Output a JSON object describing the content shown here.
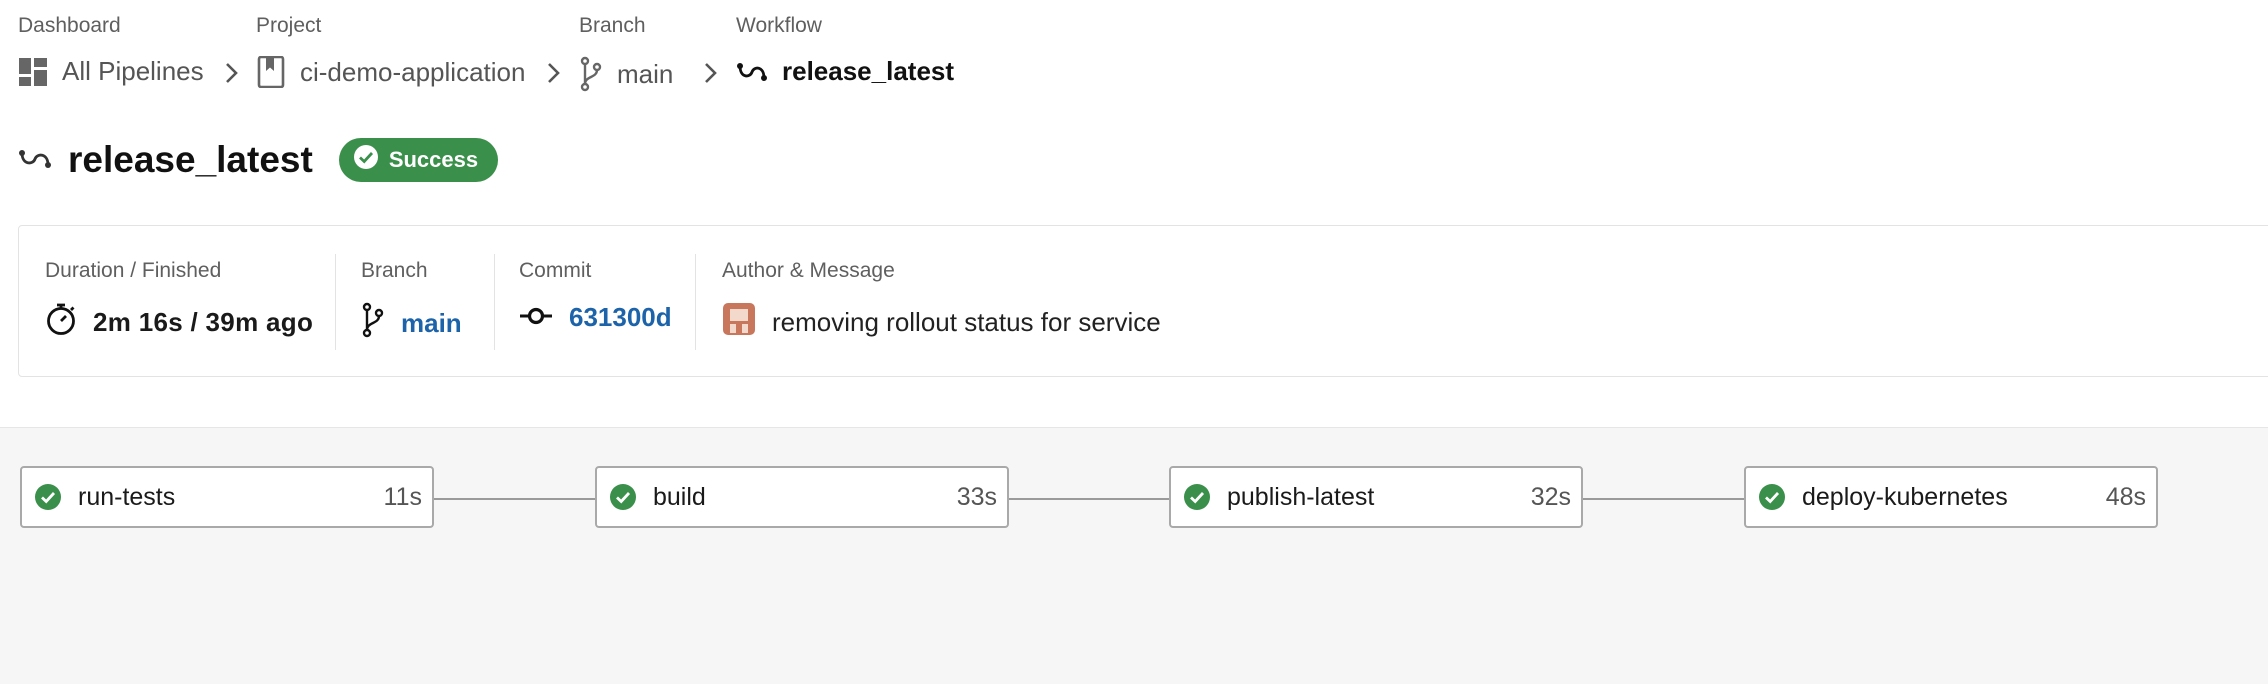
{
  "breadcrumb": {
    "dashboard": {
      "caption": "Dashboard",
      "label": "All Pipelines",
      "icon": "dashboard-icon"
    },
    "project": {
      "caption": "Project",
      "label": "ci-demo-application",
      "icon": "bookmark-icon"
    },
    "branch": {
      "caption": "Branch",
      "label": "main",
      "icon": "git-branch-icon"
    },
    "workflow": {
      "caption": "Workflow",
      "label": "release_latest",
      "icon": "workflow-icon"
    }
  },
  "header": {
    "title": "release_latest",
    "status": "Success",
    "status_color": "#3a8f4b"
  },
  "info": {
    "duration": {
      "label": "Duration / Finished",
      "value": "2m 16s / 39m ago",
      "icon": "stopwatch-icon"
    },
    "branch": {
      "label": "Branch",
      "value": "main",
      "icon": "git-branch-icon"
    },
    "commit": {
      "label": "Commit",
      "value": "631300d",
      "icon": "commit-icon"
    },
    "author": {
      "label": "Author & Message",
      "message": "removing rollout status for service",
      "icon": "avatar"
    }
  },
  "jobs": [
    {
      "name": "run-tests",
      "duration": "11s",
      "status": "success"
    },
    {
      "name": "build",
      "duration": "33s",
      "status": "success"
    },
    {
      "name": "publish-latest",
      "duration": "32s",
      "status": "success"
    },
    {
      "name": "deploy-kubernetes",
      "duration": "48s",
      "status": "success"
    }
  ],
  "colors": {
    "success": "#3a8f4b",
    "link": "#1c63a9",
    "avatar": "#c8765c"
  }
}
